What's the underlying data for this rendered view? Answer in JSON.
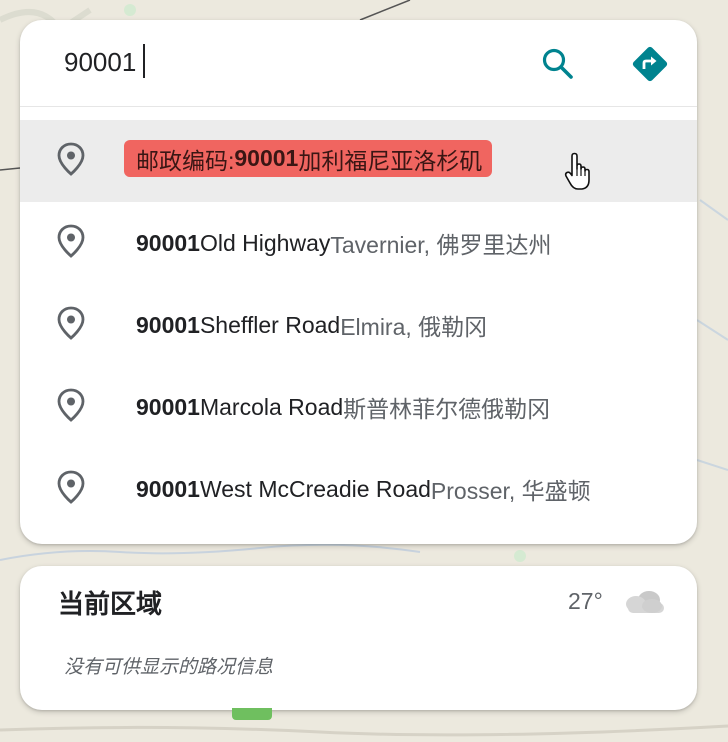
{
  "search": {
    "value": "90001",
    "search_icon": "search-icon",
    "directions_icon": "directions-icon"
  },
  "suggestions": [
    {
      "prefix": "邮政编码: ",
      "main": "90001",
      "rest": " 加利福尼亚洛杉矶",
      "secondary": "",
      "hovered": true
    },
    {
      "prefix": "",
      "main": "90001",
      "rest": " Old Highway",
      "secondary": " Tavernier, 佛罗里达州",
      "hovered": false
    },
    {
      "prefix": "",
      "main": "90001",
      "rest": " Sheffler Road",
      "secondary": " Elmira, 俄勒冈",
      "hovered": false
    },
    {
      "prefix": "",
      "main": "90001",
      "rest": " Marcola Road",
      "secondary": " 斯普林菲尔德俄勒冈",
      "hovered": false
    },
    {
      "prefix": "",
      "main": "90001",
      "rest": " West McCreadie Road",
      "secondary": " Prosser, 华盛顿",
      "hovered": false
    }
  ],
  "area": {
    "title": "当前区域",
    "temperature": "27°",
    "weather_icon": "cloudy-icon",
    "note": "没有可供显示的路况信息"
  },
  "colors": {
    "accent": "#00838f",
    "highlight": "#f06560",
    "map_bg": "#ece9de"
  }
}
